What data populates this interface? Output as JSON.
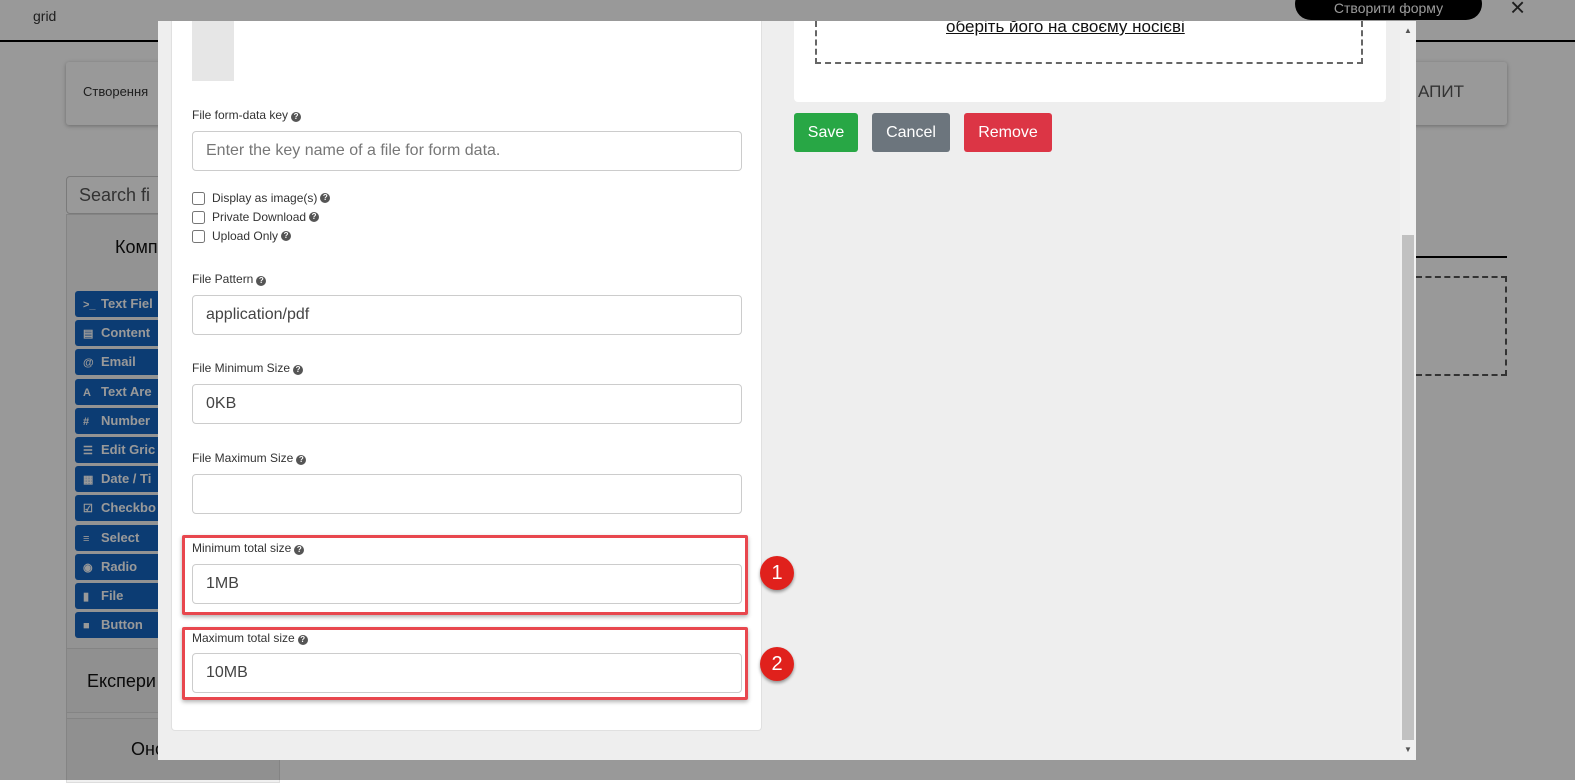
{
  "background": {
    "header_sub": "grid",
    "create_form_button": "Створити форму",
    "close_icon": "×",
    "card_left": "Створення",
    "card_right": "АПИТ",
    "search_placeholder": "Search fi",
    "components_title": "Комп",
    "components": [
      {
        "icon": ">_",
        "label": "Text Fiel"
      },
      {
        "icon": "▤",
        "label": "Content"
      },
      {
        "icon": "@",
        "label": "Email"
      },
      {
        "icon": "A",
        "label": "Text Are"
      },
      {
        "icon": "#",
        "label": "Number"
      },
      {
        "icon": "☰",
        "label": "Edit Gric"
      },
      {
        "icon": "▦",
        "label": "Date / Ti"
      },
      {
        "icon": "☑",
        "label": "Checkbo"
      },
      {
        "icon": "≡",
        "label": "Select"
      },
      {
        "icon": "◉",
        "label": "Radio"
      },
      {
        "icon": "▮",
        "label": "File"
      },
      {
        "icon": "■",
        "label": "Button"
      }
    ],
    "section_experimental": "Експери",
    "section_other": "Оно"
  },
  "modal": {
    "file_key_label": "File form-data key",
    "file_key_placeholder": "Enter the key name of a file for form data.",
    "checkboxes": [
      {
        "label": "Display as image(s)",
        "checked": false
      },
      {
        "label": "Private Download",
        "checked": false
      },
      {
        "label": "Upload Only",
        "checked": false
      }
    ],
    "file_pattern_label": "File Pattern",
    "file_pattern_value": "application/pdf",
    "file_min_label": "File Minimum Size",
    "file_min_value": "0KB",
    "file_max_label": "File Maximum Size",
    "file_max_value": "",
    "min_total_label": "Minimum total size",
    "min_total_value": "1MB",
    "max_total_label": "Maximum total size",
    "max_total_value": "10MB",
    "upload_link": "оберіть його на своєму носієві",
    "save": "Save",
    "cancel": "Cancel",
    "remove": "Remove",
    "badges": [
      "1",
      "2"
    ]
  },
  "colors": {
    "save": "#28a745",
    "cancel": "#6c757d",
    "remove": "#dc3545",
    "highlight": "#e8474e",
    "component": "#1565c0"
  }
}
